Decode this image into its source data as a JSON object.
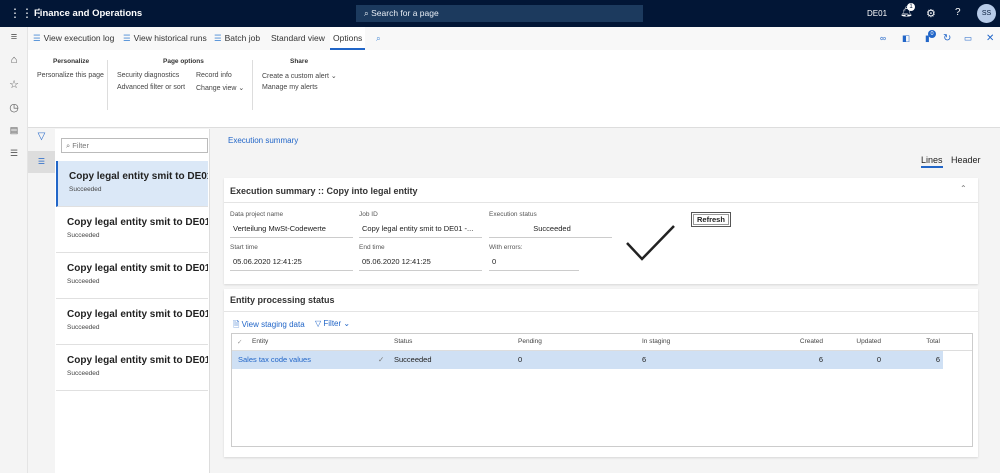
{
  "header": {
    "app_title": "Finance and Operations",
    "search_placeholder": "Search for a page",
    "company": "DE01",
    "notification_count": "1",
    "avatar_initials": "SS"
  },
  "actionbar": {
    "items": [
      "View execution log",
      "View historical runs",
      "Batch job",
      "Standard view",
      "Options"
    ],
    "attachments_count": "0"
  },
  "ribbon": {
    "groups": [
      {
        "title": "Personalize",
        "items": [
          "Personalize this page"
        ]
      },
      {
        "title": "Page options",
        "items": [
          "Security diagnostics",
          "Advanced filter or sort",
          "Record info",
          "Change view"
        ]
      },
      {
        "title": "Share",
        "items": [
          "Create a custom alert",
          "Manage my alerts"
        ]
      }
    ]
  },
  "list": {
    "filter_placeholder": "Filter",
    "items": [
      {
        "title": "Copy legal entity smit to DE01",
        "status": "Succeeded"
      },
      {
        "title": "Copy legal entity smit to DE01",
        "status": "Succeeded"
      },
      {
        "title": "Copy legal entity smit to DE01",
        "status": "Succeeded"
      },
      {
        "title": "Copy legal entity smit to DE01",
        "status": "Succeeded"
      },
      {
        "title": "Copy legal entity smit to DE01",
        "status": "Succeeded"
      }
    ]
  },
  "main": {
    "breadcrumb": "Execution summary",
    "view_tabs": [
      "Lines",
      "Header"
    ],
    "summary": {
      "title": "Execution summary :: Copy into legal entity",
      "refresh": "Refresh",
      "fields": {
        "project_label": "Data project name",
        "project": "Verteilung MwSt-Codewerte",
        "job_label": "Job ID",
        "job": "Copy legal entity smit to DE01 -...",
        "status_label": "Execution status",
        "status": "Succeeded",
        "start_label": "Start time",
        "start": "05.06.2020 12:41:25",
        "end_label": "End time",
        "end": "05.06.2020 12:41:25",
        "errors_label": "With errors:",
        "errors": "0"
      }
    },
    "entity": {
      "title": "Entity processing status",
      "view_staging": "View staging data",
      "filter": "Filter",
      "columns": [
        "Entity",
        "Status",
        "Pending",
        "In staging",
        "Created",
        "Updated",
        "Total"
      ],
      "rows": [
        {
          "entity": "Sales tax code values",
          "status": "Succeeded",
          "pending": "0",
          "in_staging": "6",
          "created": "6",
          "updated": "0",
          "total": "6"
        }
      ]
    }
  }
}
